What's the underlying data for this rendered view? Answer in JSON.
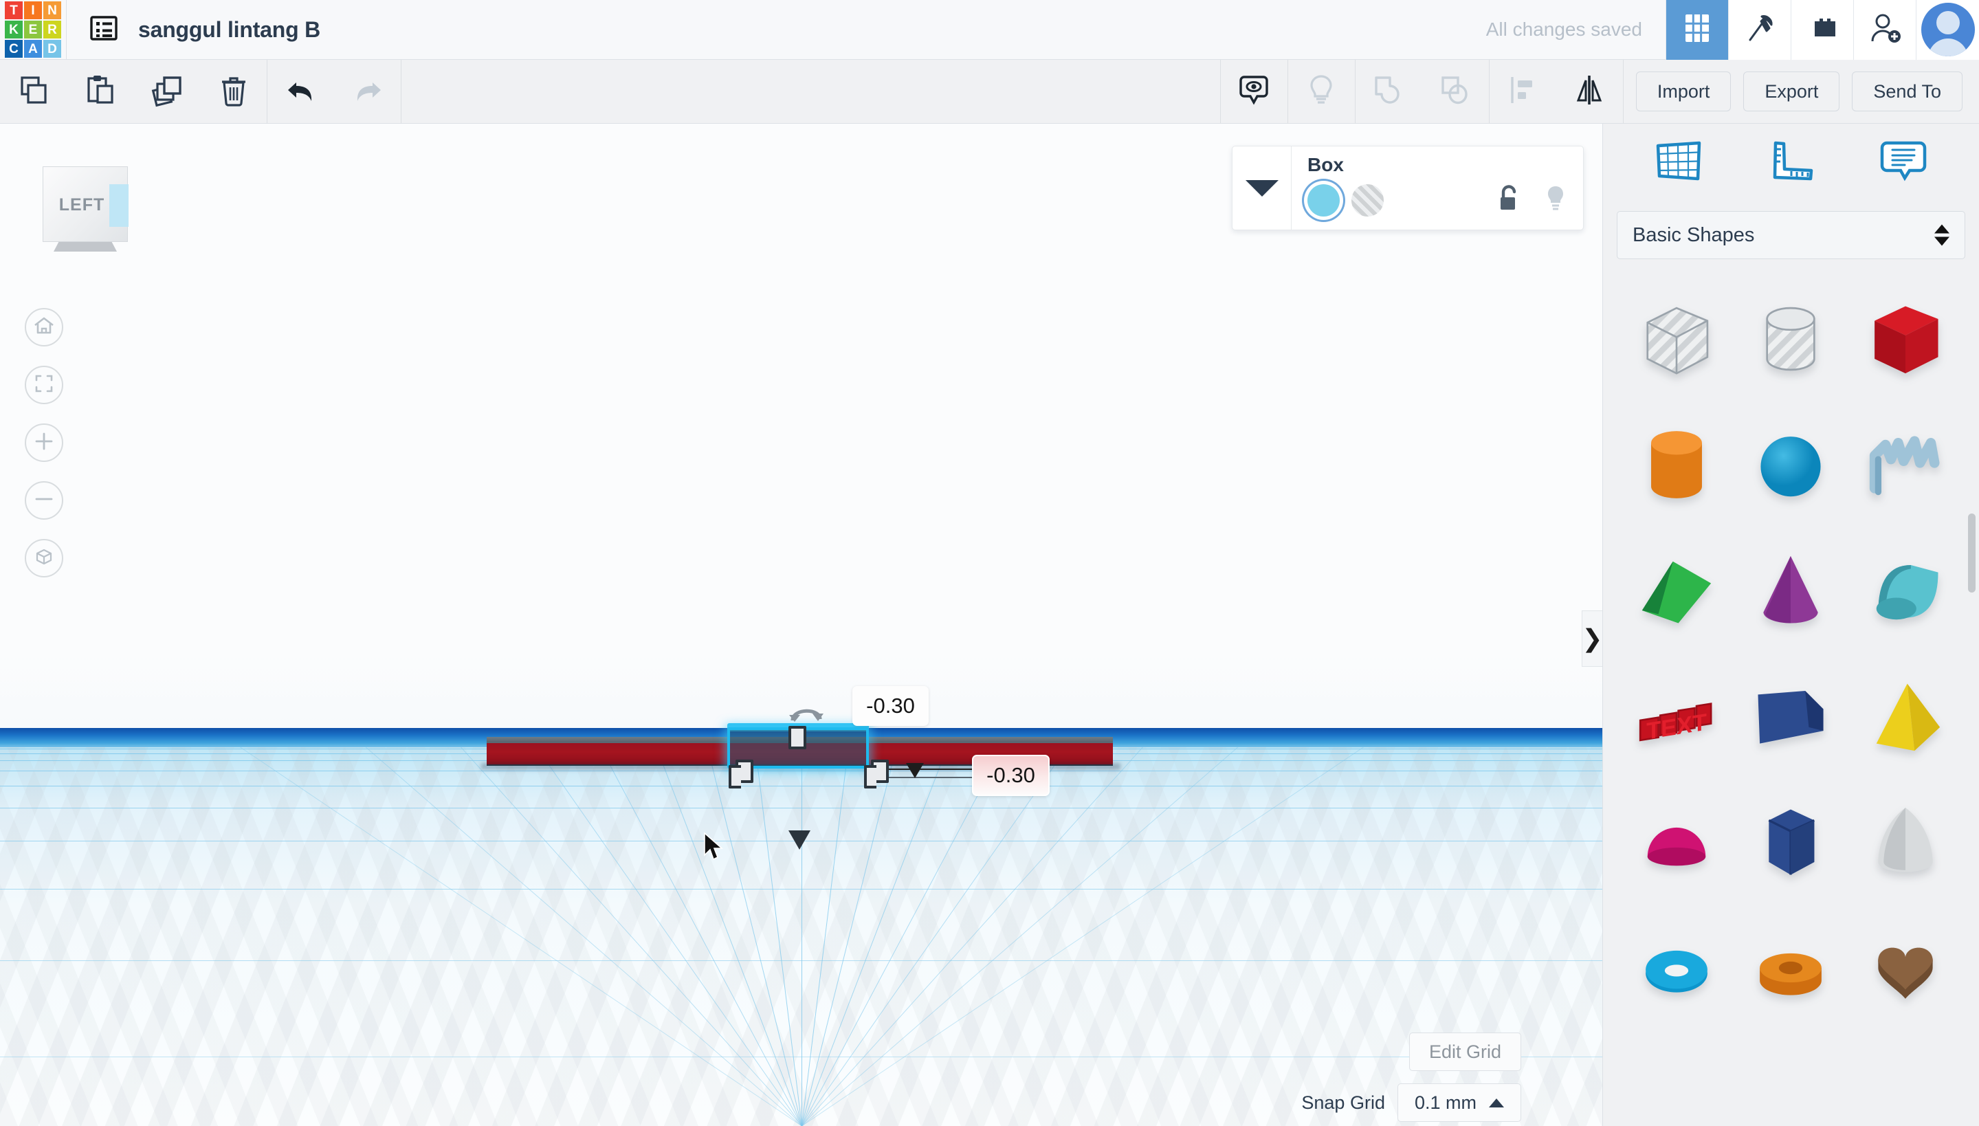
{
  "app": {
    "brand_letters": [
      "T",
      "I",
      "N",
      "K",
      "E",
      "R",
      "C",
      "A",
      "D"
    ],
    "brand_colors": [
      "#ef4135",
      "#f7771f",
      "#f59b35",
      "#3ab54a",
      "#8cc63f",
      "#cdd51f",
      "#0e62ac",
      "#3e8ede",
      "#76c4e8"
    ],
    "project_title": "sanggul lintang B",
    "save_status": "All changes saved"
  },
  "topbar": {
    "doclist_icon": "list-icon",
    "icons": [
      {
        "name": "grid-view-icon",
        "active": true
      },
      {
        "name": "pickaxe-icon",
        "active": false
      },
      {
        "name": "lego-brick-icon",
        "active": false
      },
      {
        "name": "add-person-icon",
        "active": false
      }
    ],
    "avatar_icon": "user-avatar"
  },
  "toolbar": {
    "left_tools": [
      {
        "name": "copy-icon",
        "label": "Copy",
        "enabled": true
      },
      {
        "name": "paste-icon",
        "label": "Paste",
        "enabled": true
      },
      {
        "name": "duplicate-icon",
        "label": "Duplicate",
        "enabled": true
      },
      {
        "name": "delete-icon",
        "label": "Delete",
        "enabled": true
      },
      {
        "name": "undo-icon",
        "label": "Undo",
        "enabled": true
      },
      {
        "name": "redo-icon",
        "label": "Redo",
        "enabled": false
      }
    ],
    "right_tools": [
      {
        "name": "show-hide-icon",
        "label": "Show/Hide",
        "enabled": true
      },
      {
        "name": "lightbulb-icon",
        "label": "Light",
        "enabled": false
      },
      {
        "name": "group-icon",
        "label": "Group",
        "enabled": false
      },
      {
        "name": "ungroup-icon",
        "label": "Ungroup",
        "enabled": false
      },
      {
        "name": "align-icon",
        "label": "Align",
        "enabled": false
      },
      {
        "name": "mirror-icon",
        "label": "Mirror",
        "enabled": true
      }
    ],
    "import_label": "Import",
    "export_label": "Export",
    "sendto_label": "Send To"
  },
  "shape_panel": {
    "title": "Box",
    "solid_color": "#79d1ea",
    "hole_label": "Hole",
    "lock_icon": "unlock-icon",
    "light_icon": "lightbulb-icon"
  },
  "viewport": {
    "view_cube_label": "LEFT",
    "nav_buttons": [
      {
        "name": "home-view-button",
        "icon": "home-icon"
      },
      {
        "name": "fit-view-button",
        "icon": "frame-icon"
      },
      {
        "name": "zoom-in-button",
        "icon": "plus-icon"
      },
      {
        "name": "zoom-out-button",
        "icon": "minus-icon"
      },
      {
        "name": "ortho-toggle-button",
        "icon": "cube-icon"
      }
    ],
    "tooltip_height": "-0.30",
    "tooltip_offset": "-0.30",
    "panel_chevron": "❯",
    "slab_color": "#a5141f",
    "selection_color": "#1fbbef"
  },
  "sidebar": {
    "tab_icons": [
      {
        "name": "workplane-icon"
      },
      {
        "name": "ruler-icon"
      },
      {
        "name": "notes-icon"
      }
    ],
    "category": "Basic Shapes",
    "shapes": [
      {
        "name": "box-hole",
        "label": "Box Hole"
      },
      {
        "name": "cylinder-hole",
        "label": "Cylinder Hole"
      },
      {
        "name": "box-red",
        "label": "Box"
      },
      {
        "name": "cylinder-orange",
        "label": "Cylinder"
      },
      {
        "name": "sphere-blue",
        "label": "Sphere"
      },
      {
        "name": "scribble",
        "label": "Scribble"
      },
      {
        "name": "roof-green",
        "label": "Roof"
      },
      {
        "name": "cone-purple",
        "label": "Cone"
      },
      {
        "name": "round-roof-teal",
        "label": "Round Roof"
      },
      {
        "name": "text-red",
        "label": "Text"
      },
      {
        "name": "wedge-blue",
        "label": "Wedge"
      },
      {
        "name": "pyramid-yellow",
        "label": "Pyramid"
      },
      {
        "name": "dome-pink",
        "label": "Half Sphere"
      },
      {
        "name": "hexagon-blue",
        "label": "Polygon"
      },
      {
        "name": "paraboloid-gray",
        "label": "Paraboloid"
      },
      {
        "name": "torus-cyan",
        "label": "Torus"
      },
      {
        "name": "tube-orange",
        "label": "Tube"
      },
      {
        "name": "heart-brown",
        "label": "Heart"
      }
    ]
  },
  "bottom": {
    "edit_grid_label": "Edit Grid",
    "snap_grid_label": "Snap Grid",
    "snap_grid_value": "0.1 mm"
  }
}
